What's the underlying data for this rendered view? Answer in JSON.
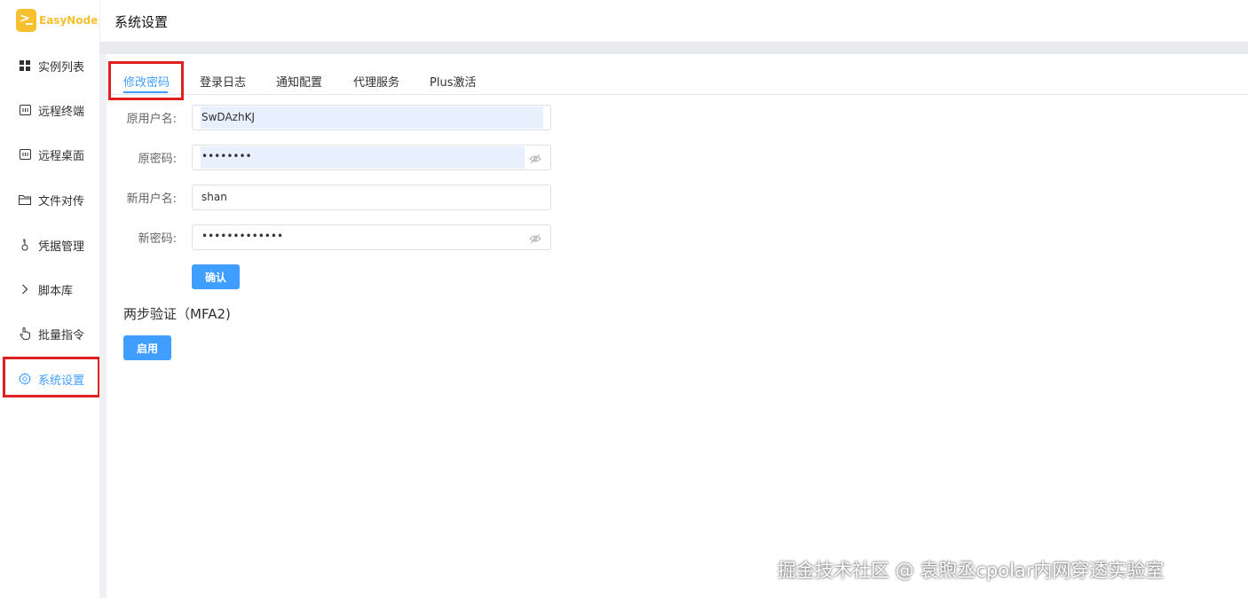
{
  "app": {
    "name": "EasyNode",
    "page_title": "系统设置"
  },
  "sidebar": {
    "items": [
      {
        "label": "实例列表",
        "icon": "grid-icon"
      },
      {
        "label": "远程终端",
        "icon": "terminal-icon"
      },
      {
        "label": "远程桌面",
        "icon": "desktop-icon"
      },
      {
        "label": "文件对传",
        "icon": "folder-icon"
      },
      {
        "label": "凭据管理",
        "icon": "key-icon"
      },
      {
        "label": "脚本库",
        "icon": "chevron-right-icon"
      },
      {
        "label": "批量指令",
        "icon": "pointer-icon"
      },
      {
        "label": "系统设置",
        "icon": "gear-icon",
        "active": true
      }
    ]
  },
  "tabs": [
    {
      "label": "修改密码",
      "active": true
    },
    {
      "label": "登录日志"
    },
    {
      "label": "通知配置"
    },
    {
      "label": "代理服务"
    },
    {
      "label": "Plus激活"
    }
  ],
  "form": {
    "old_username_label": "原用户名:",
    "old_username_value": "SwDAzhKJ",
    "old_password_label": "原密码:",
    "old_password_value": "••••••••",
    "new_username_label": "新用户名:",
    "new_username_value": "shan",
    "new_password_label": "新密码:",
    "new_password_value": "•••••••••••••",
    "confirm_label": "确认"
  },
  "mfa": {
    "title": "两步验证（MFA2)",
    "enable_label": "启用"
  },
  "watermark": "掘金技术社区 @ 袁煦丞cpolar内网穿透实验室",
  "colors": {
    "accent": "#409eff",
    "highlight": "#e0201e",
    "logo": "#f6c02e"
  }
}
